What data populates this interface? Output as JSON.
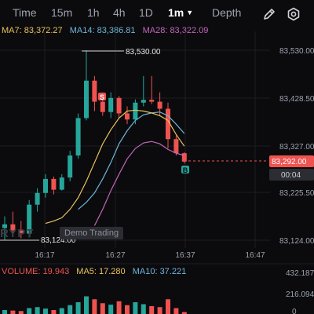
{
  "timeframes": {
    "time": "Time",
    "m15": "15m",
    "h1": "1h",
    "h4": "4h",
    "d1": "1D",
    "m1": "1m",
    "depth": "Depth"
  },
  "icons": {
    "edit": "pencil-icon",
    "settings": "gear-icon"
  },
  "ma_legend": {
    "ma7": "MA7: 83,372.27",
    "ma14": "MA14: 83,386.81",
    "ma28": "MA28: 83,322.09",
    "colors": {
      "ma7": "#e8c35a",
      "ma14": "#6fb6d6",
      "ma28": "#c266b8"
    }
  },
  "price_axis": {
    "labels": [
      "83,530.00",
      "83,428.50",
      "83,327.00",
      "83,225.50",
      "83,124.00"
    ],
    "current_price": "83,292.00",
    "countdown": "00:04"
  },
  "markers": {
    "high": "83,530.00",
    "low": "83,124.00",
    "sell": "S",
    "buy": "B"
  },
  "time_axis": [
    "16:17",
    "16:27",
    "16:37",
    "16:47"
  ],
  "watermark": "RYPT",
  "demo_badge": "Demo Trading",
  "volume_legend": {
    "volume": "VOLUME: 19.943",
    "ma5": "MA5: 17.280",
    "ma10": "MA10: 37.221",
    "colors": {
      "volume": "#ef5350",
      "ma5": "#e8c35a",
      "ma10": "#6fb6d6"
    }
  },
  "volume_axis": [
    "432.187",
    "216.094",
    "0"
  ],
  "colors": {
    "up": "#26a69a",
    "down": "#ef5350"
  },
  "chart_data": {
    "type": "candlestick",
    "ylim": [
      83124,
      83530
    ],
    "candles": [
      {
        "o": 83150,
        "h": 83175,
        "l": 83124,
        "c": 83158
      },
      {
        "o": 83158,
        "h": 83185,
        "l": 83135,
        "c": 83145
      },
      {
        "o": 83145,
        "h": 83165,
        "l": 83128,
        "c": 83138
      },
      {
        "o": 83138,
        "h": 83210,
        "l": 83130,
        "c": 83200
      },
      {
        "o": 83200,
        "h": 83235,
        "l": 83185,
        "c": 83225
      },
      {
        "o": 83225,
        "h": 83265,
        "l": 83215,
        "c": 83255
      },
      {
        "o": 83255,
        "h": 83260,
        "l": 83222,
        "c": 83232
      },
      {
        "o": 83232,
        "h": 83265,
        "l": 83230,
        "c": 83258
      },
      {
        "o": 83258,
        "h": 83315,
        "l": 83250,
        "c": 83305
      },
      {
        "o": 83305,
        "h": 83395,
        "l": 83298,
        "c": 83385
      },
      {
        "o": 83385,
        "h": 83530,
        "l": 83380,
        "c": 83465
      },
      {
        "o": 83465,
        "h": 83475,
        "l": 83400,
        "c": 83420
      },
      {
        "o": 83420,
        "h": 83440,
        "l": 83390,
        "c": 83398
      },
      {
        "o": 83398,
        "h": 83440,
        "l": 83385,
        "c": 83428
      },
      {
        "o": 83428,
        "h": 83432,
        "l": 83385,
        "c": 83395
      },
      {
        "o": 83395,
        "h": 83410,
        "l": 83372,
        "c": 83382
      },
      {
        "o": 83382,
        "h": 83425,
        "l": 83372,
        "c": 83418
      },
      {
        "o": 83418,
        "h": 83475,
        "l": 83410,
        "c": 83424
      },
      {
        "o": 83424,
        "h": 83475,
        "l": 83415,
        "c": 83420
      },
      {
        "o": 83420,
        "h": 83440,
        "l": 83390,
        "c": 83405
      },
      {
        "o": 83405,
        "h": 83418,
        "l": 83320,
        "c": 83340
      },
      {
        "o": 83340,
        "h": 83348,
        "l": 83305,
        "c": 83310
      },
      {
        "o": 83310,
        "h": 83312,
        "l": 83288,
        "c": 83292
      }
    ],
    "ma7": [
      83160,
      83165,
      83172,
      83190,
      83215,
      83250,
      83290,
      83330,
      83360,
      83385,
      83400,
      83402,
      83400,
      83396,
      83390,
      83380,
      83350,
      83325
    ],
    "ma14": [
      83190,
      83205,
      83225,
      83255,
      83290,
      83330,
      83358,
      83380,
      83392,
      83396,
      83398,
      83390,
      83372,
      83352
    ],
    "ma28": [
      83155,
      83190,
      83230,
      83265,
      83298,
      83320,
      83332,
      83335,
      83330,
      83318,
      83310,
      83305
    ],
    "volume": [
      40,
      35,
      30,
      60,
      70,
      55,
      40,
      60,
      90,
      120,
      180,
      150,
      110,
      95,
      130,
      90,
      120,
      100,
      80,
      70,
      150,
      60,
      20
    ],
    "volume_ylim": [
      0,
      432.187
    ]
  }
}
